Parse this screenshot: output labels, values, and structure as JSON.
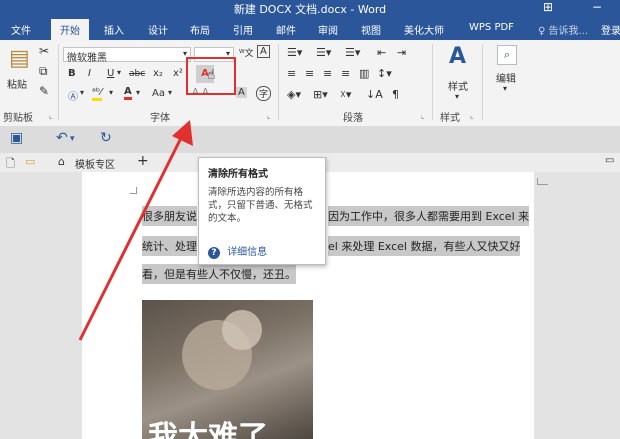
{
  "window": {
    "title": "新建 DOCX 文档.docx - Word"
  },
  "tabs": [
    {
      "label": "文件"
    },
    {
      "label": "开始"
    },
    {
      "label": "插入"
    },
    {
      "label": "设计"
    },
    {
      "label": "布局"
    },
    {
      "label": "引用"
    },
    {
      "label": "邮件"
    },
    {
      "label": "审阅"
    },
    {
      "label": "视图"
    },
    {
      "label": "美化大师"
    },
    {
      "label": "WPS PDF"
    },
    {
      "label": "告诉我..."
    },
    {
      "label": "登录"
    }
  ],
  "ribbon": {
    "paste_label": "粘贴",
    "font_name": "微软雅黑",
    "font_size": "",
    "groups": {
      "clipboard": "剪贴板",
      "font": "字体",
      "paragraph": "段落",
      "styles": "样式",
      "style_btn": "样式",
      "edit": "编辑"
    },
    "tools": {
      "bold": "B",
      "italic": "I",
      "underline": "U",
      "strike": "abc",
      "sub": "x₂",
      "sup": "x²",
      "aa": "Aa",
      "font_color": "A",
      "clear_format": "A"
    },
    "highlight_color": "#e0302f",
    "accent": "#2b579a"
  },
  "doc_tabs": {
    "templates": "模板专区",
    "plus": "+"
  },
  "tooltip": {
    "title": "清除所有格式",
    "description": "清除所选内容的所有格式，只留下普通、无格式的文本。",
    "link": "详细信息"
  },
  "document": {
    "line1_start": "很多朋友说",
    "line1_end": "因为工作中，很多人都需要用到 Excel 来",
    "line2_start": "统计、处理",
    "line2_end": "el 来处理 Excel 数据，有些人又快又好",
    "line3": "看，但是有些人不仅慢，还丑。",
    "image_caption": "我太难了"
  }
}
